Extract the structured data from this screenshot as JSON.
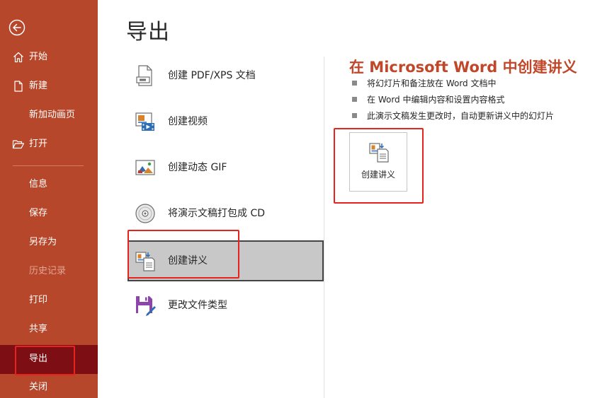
{
  "sidebar": {
    "back_icon": "back-arrow-icon",
    "items": [
      {
        "label": "开始",
        "icon": "home-icon"
      },
      {
        "label": "新建",
        "icon": "new-file-icon"
      },
      {
        "label": "新加动画页"
      },
      {
        "label": "打开",
        "icon": "open-folder-icon"
      },
      {
        "label": "信息"
      },
      {
        "label": "保存"
      },
      {
        "label": "另存为"
      },
      {
        "label": "历史记录"
      },
      {
        "label": "打印"
      },
      {
        "label": "共享"
      },
      {
        "label": "导出"
      },
      {
        "label": "关闭"
      }
    ],
    "active": "导出",
    "disabled": "历史记录"
  },
  "main": {
    "title": "导出",
    "options": [
      {
        "label": "创建 PDF/XPS 文档",
        "icon": "pdf-document-icon"
      },
      {
        "label": "创建视频",
        "icon": "video-icon"
      },
      {
        "label": "创建动态 GIF",
        "icon": "gif-image-icon"
      },
      {
        "label": "将演示文稿打包成 CD",
        "icon": "cd-disc-icon"
      },
      {
        "label": "创建讲义",
        "icon": "handout-icon"
      },
      {
        "label": "更改文件类型",
        "icon": "change-file-type-icon"
      }
    ],
    "selected_option": "创建讲义"
  },
  "detail": {
    "title": "在 Microsoft Word 中创建讲义",
    "bullets": [
      "将幻灯片和备注放在 Word 文档中",
      "在 Word 中编辑内容和设置内容格式",
      "此演示文稿发生更改时，自动更新讲义中的幻灯片"
    ],
    "button_label": "创建讲义",
    "button_icon": "handout-icon"
  },
  "colors": {
    "sidebar_bg": "#b7472a",
    "sidebar_active": "#7d0f14",
    "accent_title": "#c0472a",
    "highlight_box": "#e8221c",
    "selected_bg": "#c8c8c8"
  }
}
